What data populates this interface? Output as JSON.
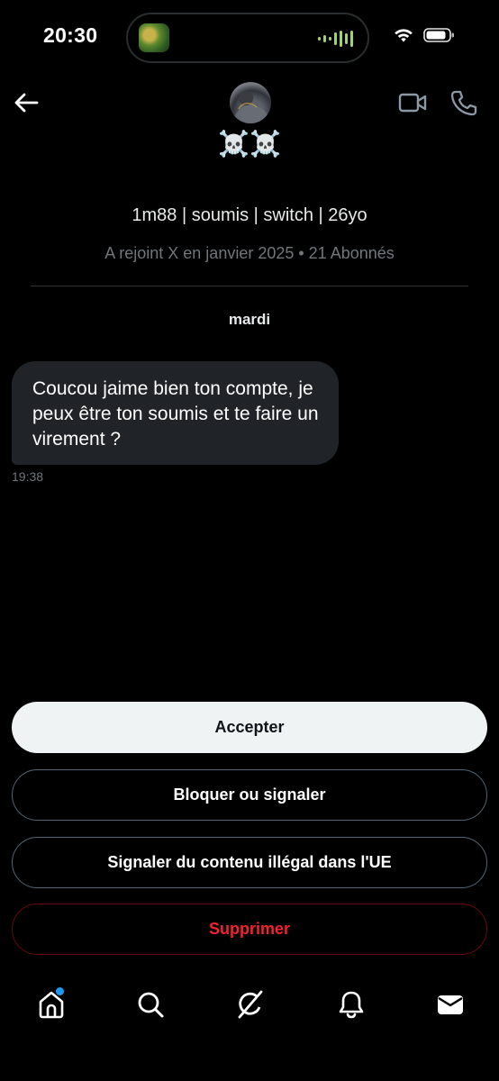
{
  "status_bar": {
    "time": "20:30"
  },
  "header": {
    "display_name": "☠️☠️",
    "bio": "1m88 | soumis | switch | 26yo",
    "meta": "A rejoint X en janvier 2025 • 21 Abonnés"
  },
  "conversation": {
    "day_label": "mardi",
    "messages": [
      {
        "text": "Coucou jaime bien ton compte, je peux être ton soumis et te faire un virement ?",
        "time": "19:38"
      }
    ]
  },
  "actions": {
    "accept_label": "Accepter",
    "block_label": "Bloquer ou signaler",
    "report_label": "Signaler du contenu illégal dans l'UE",
    "delete_label": "Supprimer"
  },
  "bottom_nav": {
    "items": [
      "home-icon",
      "search-icon",
      "grok-icon",
      "notifications-icon",
      "messages-icon"
    ],
    "home_has_badge": true
  },
  "colors": {
    "background": "#000000",
    "bubble": "#202327",
    "muted": "#71767b",
    "danger": "#f4212e",
    "badge": "#1d9bf0"
  }
}
